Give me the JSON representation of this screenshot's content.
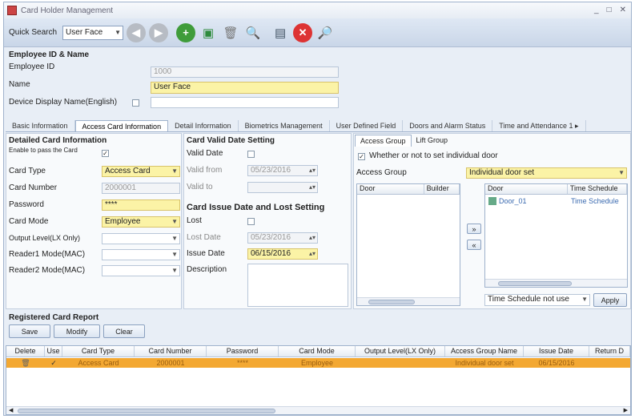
{
  "window": {
    "title": "Card Holder Management",
    "controls": [
      "_",
      "□",
      "✕"
    ]
  },
  "toolbar": {
    "quick_search_label": "Quick Search",
    "quick_search_value": "User Face"
  },
  "employee": {
    "section_title": "Employee ID & Name",
    "employee_id_label": "Employee ID",
    "employee_id_value": "1000",
    "name_label": "Name",
    "name_value": "User Face",
    "device_name_label": "Device Display Name(English)"
  },
  "tabs": [
    "Basic Information",
    "Access Card Information",
    "Detail Information",
    "Biometrics Management",
    "User Defined Field",
    "Doors and Alarm Status",
    "Time and Attendance 1 ▸"
  ],
  "card_detail": {
    "title": "Detailed Card Information",
    "enabled_label": "Enable to pass the Card",
    "card_type_label": "Card Type",
    "card_type_value": "Access Card",
    "card_number_label": "Card Number",
    "card_number_value": "2000001",
    "password_label": "Password",
    "password_value": "****",
    "card_mode_label": "Card Mode",
    "card_mode_value": "Employee",
    "output_level_label": "Output Level(LX Only)",
    "reader1_label": "Reader1 Mode(MAC)",
    "reader2_label": "Reader2 Mode(MAC)"
  },
  "validity": {
    "title": "Card Valid Date Setting",
    "valid_date_label": "Valid Date",
    "valid_from_label": "Valid from",
    "valid_from_value": "05/23/2016",
    "valid_to_label": "Valid to"
  },
  "issue": {
    "title": "Card Issue Date and Lost Setting",
    "lost_label": "Lost",
    "lost_date_label": "Lost Date",
    "lost_date_value": "05/23/2016",
    "issue_date_label": "Issue Date",
    "issue_date_value": "06/15/2016",
    "description_label": "Description"
  },
  "access": {
    "tabs": [
      "Access Group",
      "Lift Group"
    ],
    "individual_label": "Whether or not to set individual door",
    "access_group_label": "Access Group",
    "access_group_value": "Individual door set",
    "left_cols": [
      "Door",
      "Builder"
    ],
    "right_cols": [
      "Door",
      "Time Schedule"
    ],
    "right_rows": [
      {
        "door": "Door_01",
        "schedule": "Time Schedule"
      }
    ],
    "time_schedule_value": "Time Schedule not use",
    "apply_label": "Apply"
  },
  "report": {
    "title": "Registered Card Report",
    "buttons": [
      "Save",
      "Modify",
      "Clear"
    ],
    "columns": [
      "Delete",
      "Use",
      "Card Type",
      "Card Number",
      "Password",
      "Card Mode",
      "Output Level(LX Only)",
      "Access Group Name",
      "Issue Date",
      "Return D"
    ],
    "rows": [
      {
        "delete": "🗑",
        "use": "✓",
        "card_type": "Access Card",
        "card_number": "2000001",
        "password": "****",
        "card_mode": "Employee",
        "output_level": "",
        "access_group": "Individual door set",
        "issue_date": "06/15/2016",
        "return": ""
      }
    ]
  },
  "colors": {
    "highlight": "#fbf3a6",
    "row_selected": "#f3a832",
    "frame": "#e8eef6"
  }
}
